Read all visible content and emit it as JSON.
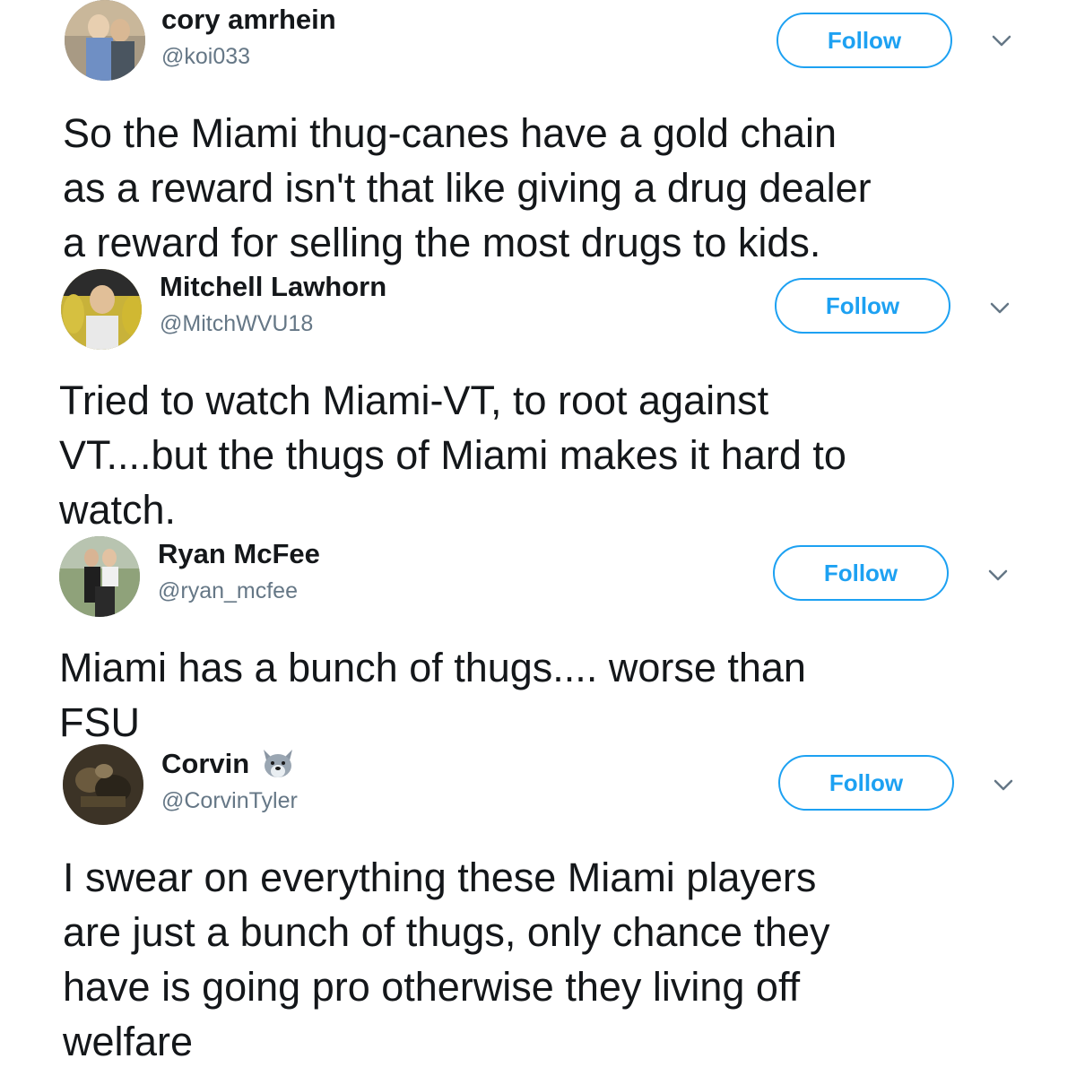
{
  "tweets": [
    {
      "name": "cory amrhein",
      "handle": "@koi033",
      "follow_label": "Follow",
      "avatar_icon": "profile-photo",
      "text_lines": [
        "So the Miami thug-canes have a gold chain",
        "as a reward isn't that like giving a drug dealer",
        "a reward for selling the most drugs to kids."
      ]
    },
    {
      "name": "Mitchell Lawhorn",
      "handle": "@MitchWVU18",
      "follow_label": "Follow",
      "avatar_icon": "profile-photo",
      "text_lines": [
        "Tried to watch Miami-VT, to root against",
        "VT....but the thugs of Miami makes it hard to",
        "watch."
      ]
    },
    {
      "name": "Ryan McFee",
      "handle": "@ryan_mcfee",
      "follow_label": "Follow",
      "avatar_icon": "profile-photo",
      "text_lines": [
        "Miami has a bunch of thugs.... worse than",
        "FSU"
      ]
    },
    {
      "name": "Corvin",
      "name_emoji": "wolf-face-emoji",
      "handle": "@CorvinTyler",
      "follow_label": "Follow",
      "avatar_icon": "profile-photo",
      "text_lines": [
        "I swear on everything these Miami players",
        "are just a bunch of thugs, only chance they",
        "have is going pro otherwise they living off",
        "welfare"
      ]
    }
  ],
  "colors": {
    "accent": "#1da1f2",
    "text": "#14171a",
    "muted": "#657786"
  }
}
